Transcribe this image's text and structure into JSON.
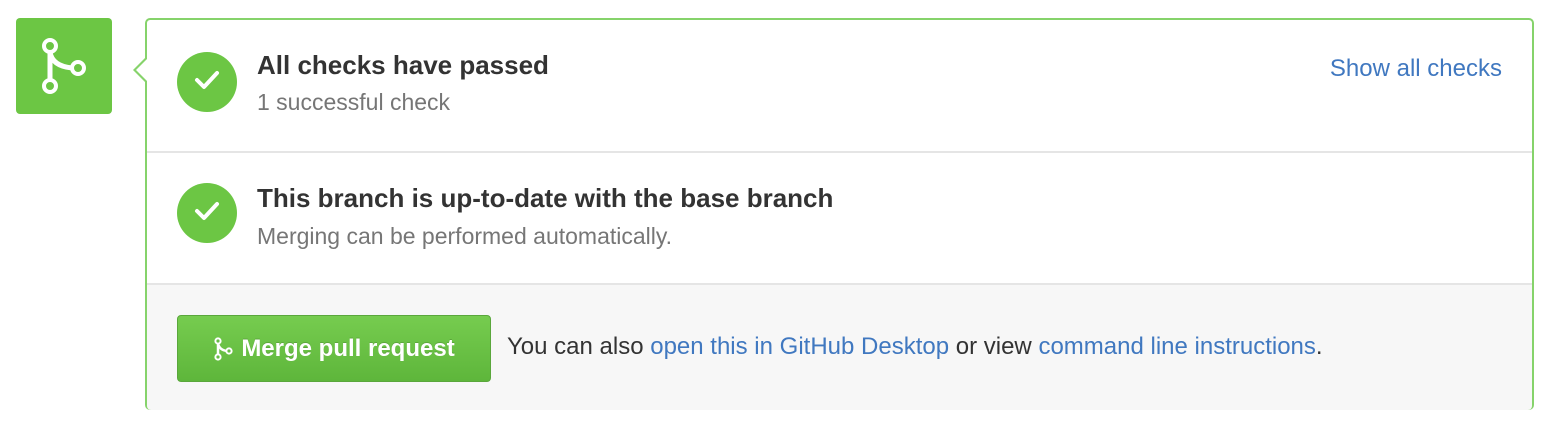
{
  "icons": {
    "merge_badge": "git-merge-icon",
    "status": "check-icon",
    "button": "git-merge-icon"
  },
  "colors": {
    "success_green": "#6cc644",
    "panel_border": "#86d36b",
    "link_blue": "#4078c0"
  },
  "checks": {
    "title": "All checks have passed",
    "description": "1 successful check",
    "show_all_link": "Show all checks"
  },
  "branch": {
    "title": "This branch is up-to-date with the base branch",
    "description": "Merging can be performed automatically."
  },
  "merge": {
    "button_label": "Merge pull request",
    "help_prefix": "You can also",
    "desktop_link": "open this in GitHub Desktop",
    "help_middle": "or view",
    "cli_link": "command line instructions",
    "help_suffix": "."
  }
}
